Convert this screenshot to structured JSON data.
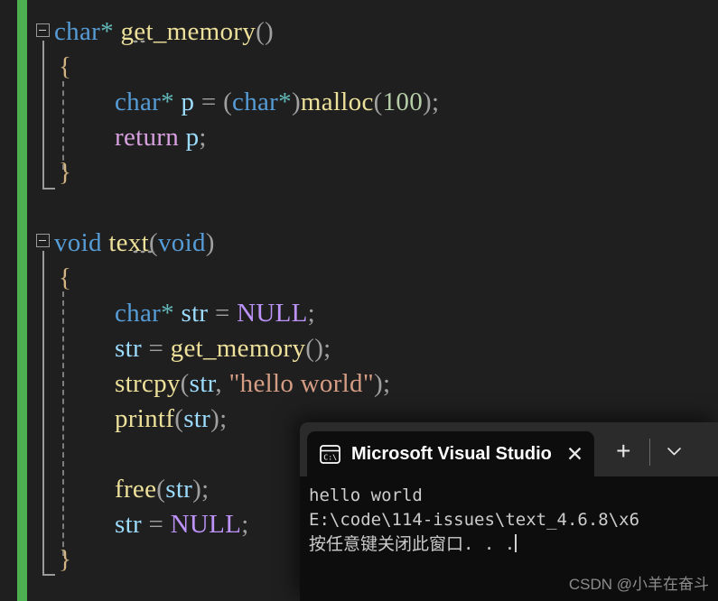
{
  "editor": {
    "background": "#1f1f1f",
    "change_bar_color": "#4caf50",
    "lines": [
      {
        "indent": 0,
        "tokens": [
          {
            "t": "char",
            "c": "kw"
          },
          {
            "t": "*",
            "c": "op"
          },
          {
            "t": " ",
            "c": "punct"
          },
          {
            "t": "get_memory",
            "c": "fn"
          },
          {
            "t": "()",
            "c": "punct"
          }
        ]
      },
      {
        "indent": 1,
        "tokens": [
          {
            "t": "{",
            "c": "brace"
          }
        ]
      },
      {
        "indent": 2,
        "tokens": [
          {
            "t": "char",
            "c": "kw"
          },
          {
            "t": "*",
            "c": "op"
          },
          {
            "t": " ",
            "c": "punct"
          },
          {
            "t": "p",
            "c": "var"
          },
          {
            "t": " = ",
            "c": "punct"
          },
          {
            "t": "(",
            "c": "punct"
          },
          {
            "t": "char",
            "c": "kw"
          },
          {
            "t": "*",
            "c": "op"
          },
          {
            "t": ")",
            "c": "punct"
          },
          {
            "t": "malloc",
            "c": "fn"
          },
          {
            "t": "(",
            "c": "punct"
          },
          {
            "t": "100",
            "c": "num"
          },
          {
            "t": ")",
            "c": "punct"
          },
          {
            "t": ";",
            "c": "punct"
          }
        ]
      },
      {
        "indent": 2,
        "tokens": [
          {
            "t": "return",
            "c": "ctrl"
          },
          {
            "t": " ",
            "c": "punct"
          },
          {
            "t": "p",
            "c": "var"
          },
          {
            "t": ";",
            "c": "punct"
          }
        ]
      },
      {
        "indent": 1,
        "tokens": [
          {
            "t": "}",
            "c": "brace"
          }
        ]
      },
      {
        "indent": 0,
        "tokens": []
      },
      {
        "indent": 0,
        "tokens": [
          {
            "t": "void",
            "c": "kw"
          },
          {
            "t": " ",
            "c": "punct"
          },
          {
            "t": "text",
            "c": "fn"
          },
          {
            "t": "(",
            "c": "punct"
          },
          {
            "t": "void",
            "c": "kw"
          },
          {
            "t": ")",
            "c": "punct"
          }
        ]
      },
      {
        "indent": 1,
        "tokens": [
          {
            "t": "{",
            "c": "brace"
          }
        ]
      },
      {
        "indent": 2,
        "tokens": [
          {
            "t": "char",
            "c": "kw"
          },
          {
            "t": "*",
            "c": "op"
          },
          {
            "t": " ",
            "c": "punct"
          },
          {
            "t": "str",
            "c": "var"
          },
          {
            "t": " = ",
            "c": "punct"
          },
          {
            "t": "NULL",
            "c": "macro"
          },
          {
            "t": ";",
            "c": "punct"
          }
        ]
      },
      {
        "indent": 2,
        "tokens": [
          {
            "t": "str",
            "c": "var"
          },
          {
            "t": " = ",
            "c": "punct"
          },
          {
            "t": "get_memory",
            "c": "fn"
          },
          {
            "t": "()",
            "c": "punct"
          },
          {
            "t": ";",
            "c": "punct"
          }
        ]
      },
      {
        "indent": 2,
        "tokens": [
          {
            "t": "strcpy",
            "c": "fn"
          },
          {
            "t": "(",
            "c": "punct"
          },
          {
            "t": "str",
            "c": "var"
          },
          {
            "t": ", ",
            "c": "punct"
          },
          {
            "t": "\"hello world\"",
            "c": "str"
          },
          {
            "t": ")",
            "c": "punct"
          },
          {
            "t": ";",
            "c": "punct"
          }
        ]
      },
      {
        "indent": 2,
        "tokens": [
          {
            "t": "printf",
            "c": "fn"
          },
          {
            "t": "(",
            "c": "punct"
          },
          {
            "t": "str",
            "c": "var"
          },
          {
            "t": ")",
            "c": "punct"
          },
          {
            "t": ";",
            "c": "punct"
          }
        ]
      },
      {
        "indent": 0,
        "tokens": []
      },
      {
        "indent": 2,
        "tokens": [
          {
            "t": "free",
            "c": "fn"
          },
          {
            "t": "(",
            "c": "punct"
          },
          {
            "t": "str",
            "c": "var"
          },
          {
            "t": ")",
            "c": "punct"
          },
          {
            "t": ";",
            "c": "punct"
          }
        ]
      },
      {
        "indent": 2,
        "tokens": [
          {
            "t": "str",
            "c": "var"
          },
          {
            "t": " = ",
            "c": "punct"
          },
          {
            "t": "NULL",
            "c": "macro"
          },
          {
            "t": ";",
            "c": "punct"
          }
        ]
      },
      {
        "indent": 1,
        "tokens": [
          {
            "t": "}",
            "c": "brace"
          }
        ]
      }
    ],
    "plain_text": [
      "char* get_memory()",
      "{",
      "    char* p = (char*)malloc(100);",
      "    return p;",
      "}",
      "",
      "void text(void)",
      "{",
      "    char* str = NULL;",
      "    str = get_memory();",
      "    strcpy(str, \"hello world\");",
      "    printf(str);",
      "",
      "    free(str);",
      "    str = NULL;",
      "}"
    ]
  },
  "terminal": {
    "tab": {
      "icon": "command-prompt-icon",
      "title": "Microsoft Visual Studio",
      "close_label": "✕"
    },
    "new_tab_label": "+",
    "dropdown_label": "⌄",
    "output_lines": [
      "hello world",
      "E:\\code\\114-issues\\text_4.6.8\\x6",
      "按任意键关闭此窗口. . ."
    ]
  },
  "watermark": {
    "text": "CSDN @小羊在奋斗"
  }
}
